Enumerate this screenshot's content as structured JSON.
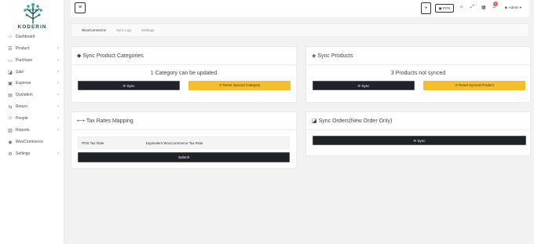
{
  "brand": {
    "name": "KODERIN",
    "color": "#1e4f5f"
  },
  "sidebar": {
    "items": [
      {
        "label": "Dashboard",
        "icon": "dashboard-icon",
        "glyph": "⌂",
        "has_chevron": false
      },
      {
        "label": "Product",
        "icon": "list-icon",
        "glyph": "☰",
        "has_chevron": true
      },
      {
        "label": "Purchase",
        "icon": "truck-icon",
        "glyph": "▭",
        "has_chevron": true
      },
      {
        "label": "Sale",
        "icon": "cart-icon",
        "glyph": "◪",
        "has_chevron": true
      },
      {
        "label": "Expense",
        "icon": "wallet-icon",
        "glyph": "▣",
        "has_chevron": true
      },
      {
        "label": "Quotation",
        "icon": "document-icon",
        "glyph": "▤",
        "has_chevron": true
      },
      {
        "label": "Return",
        "icon": "return-icon",
        "glyph": "⇆",
        "has_chevron": true
      },
      {
        "label": "People",
        "icon": "people-icon",
        "glyph": "☺",
        "has_chevron": true
      },
      {
        "label": "Reports",
        "icon": "reports-icon",
        "glyph": "▥",
        "has_chevron": true
      },
      {
        "label": "WooCommerce",
        "icon": "woocommerce-icon",
        "glyph": "◉",
        "has_chevron": false
      },
      {
        "label": "Settings",
        "icon": "gear-icon",
        "glyph": "⚙",
        "has_chevron": true
      }
    ]
  },
  "topbar": {
    "menu_glyph": "≡",
    "plus_glyph": "+",
    "pos_label": "POS",
    "notification_count": "1",
    "user_label": "Admin"
  },
  "tabs": [
    "WooCommerce",
    "Sync Log",
    "Settings"
  ],
  "cards": {
    "sync_categories": {
      "title": "Sync Product Categories",
      "message": "1 Category can be updated",
      "sync_label": "Sync",
      "reset_label": "Reset Synced Category"
    },
    "sync_products": {
      "title": "Sync Products",
      "message": "3 Products not synced",
      "sync_label": "Sync",
      "reset_label": "Reset Synced Product"
    },
    "tax_rates": {
      "title": "Tax Rates Mapping",
      "col_pos": "POS Tax Rate",
      "col_woo": "Equivalent WooCommerce Tax Rate",
      "submit_label": "Submit"
    },
    "sync_orders": {
      "title": "Sync Orders(New Order Only)",
      "sync_label": "Sync"
    }
  },
  "colors": {
    "dark_button": "#1f2229",
    "yellow_button": "#f7be2c",
    "badge": "#e85a5a"
  }
}
